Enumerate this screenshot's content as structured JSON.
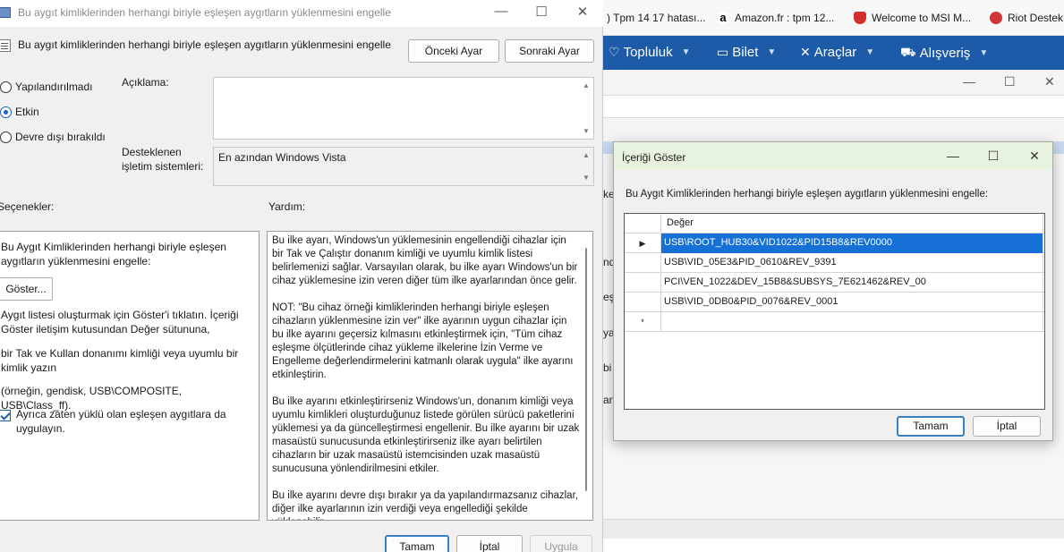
{
  "browser": {
    "bookmarks": [
      {
        "label": ") Tpm 14 17 hatası...",
        "icon": "tab-fragment-icon",
        "color": "#ffffff"
      },
      {
        "label": "Amazon.fr : tpm 12...",
        "icon": "amazon-icon",
        "color": "#000000"
      },
      {
        "label": "Welcome to MSI M...",
        "icon": "msi-shield-icon",
        "color": "#d42d2d"
      },
      {
        "label": "Riot Destek",
        "icon": "riot-icon",
        "color": "#d13639"
      }
    ],
    "nav": [
      {
        "label": "Topluluk",
        "icon": "heart-icon"
      },
      {
        "label": "Bilet",
        "icon": "ticket-icon"
      },
      {
        "label": "Araçlar",
        "icon": "tools-icon"
      },
      {
        "label": "Alışveriş",
        "icon": "cart-icon"
      }
    ],
    "nav_color": "#1d5aa8",
    "side_fragments": [
      "ke",
      "nd",
      "eş",
      "ya",
      "bi",
      "an"
    ]
  },
  "gp": {
    "title": "Bu aygıt kimliklerinden herhangi biriyle eşleşen aygıtların yüklenmesini engelle",
    "header": "Bu aygıt kimliklerinden herhangi biriyle eşleşen aygıtların yüklenmesini engelle",
    "prev_label": "Önceki Ayar",
    "next_label": "Sonraki Ayar",
    "radio_not_configured": "Yapılandırılmadı",
    "radio_enabled": "Etkin",
    "radio_disabled": "Devre dışı bırakıldı",
    "selected_state": "Etkin",
    "comment_label": "Açıklama:",
    "supported_label_1": "Desteklenen",
    "supported_label_2": "işletim sistemleri:",
    "supported_value": "En azından Windows Vista",
    "options_label": "Seçenekler:",
    "help_label": "Yardım:",
    "options": {
      "intro": "Bu Aygıt Kimliklerinden herhangi biriyle eşleşen aygıtların yüklenmesini engelle:",
      "show_button": "Göster...",
      "instruction": "Aygıt listesi oluşturmak için Göster'i tıklatın. İçeriği Göster iletişim kutusundan Değer sütununa,",
      "pnp_text": "bir Tak ve Kullan donanımı kimliği veya uyumlu bir kimlik yazın",
      "example": "(örneğin, gendisk, USB\\COMPOSITE, USB\\Class_ff).",
      "checkbox_label": "Ayrıca zaten yüklü olan eşleşen aygıtlara da uygulayın.",
      "checkbox_checked": true
    },
    "help_paragraphs": [
      "Bu ilke ayarı, Windows'un yüklemesinin engellendiği cihazlar için bir Tak ve Çalıştır donanım kimliği ve uyumlu kimlik listesi belirlemenizi sağlar. Varsayılan olarak, bu ilke ayarı Windows'un bir cihaz yüklemesine izin veren diğer tüm ilke ayarlarından önce gelir.",
      "NOT: \"Bu cihaz örneği kimliklerinden herhangi biriyle eşleşen cihazların yüklenmesine izin ver\" ilke ayarının uygun cihazlar için bu ilke ayarını geçersiz kılmasını etkinleştirmek için, \"Tüm cihaz eşleşme ölçütlerinde cihaz yükleme ilkelerine İzin Verme ve Engelleme değerlendirmelerini katmanlı olarak uygula\" ilke ayarını etkinleştirin.",
      "Bu ilke ayarını etkinleştirirseniz Windows'un, donanım kimliği veya uyumlu kimlikleri oluşturduğunuz listede görülen sürücü paketlerini yüklemesi ya da güncelleştirmesi engellenir. Bu ilke ayarını bir uzak masaüstü sunucusunda etkinleştirirseniz ilke ayarı belirtilen cihazların bir uzak masaüstü istemcisinden uzak masaüstü sunucusuna yönlendirilmesini etkiler.",
      "Bu ilke ayarını devre dışı bırakır ya da yapılandırmazsanız cihazlar, diğer ilke ayarlarının izin verdiği veya engellediği şekilde yüklenebilir."
    ],
    "ok_label": "Tamam",
    "cancel_label": "İptal",
    "apply_label": "Uygula"
  },
  "show_dialog": {
    "title": "İçeriği Göster",
    "description": "Bu Aygıt Kimliklerinden herhangi biriyle eşleşen aygıtların yüklenmesini engelle:",
    "column_header": "Değer",
    "rows": [
      "USB\\ROOT_HUB30&VID1022&PID15B8&REV0000",
      "USB\\VID_05E3&PID_0610&REV_9391",
      "PCI\\VEN_1022&DEV_15B8&SUBSYS_7E621462&REV_00",
      "USB\\VID_0DB0&PID_0076&REV_0001"
    ],
    "selected_row": 0,
    "new_row_marker": "*",
    "current_row_marker": "▶",
    "ok_label": "Tamam",
    "cancel_label": "İptal",
    "title_bar_color": "#e8f3df",
    "selection_color": "#1670d6"
  }
}
